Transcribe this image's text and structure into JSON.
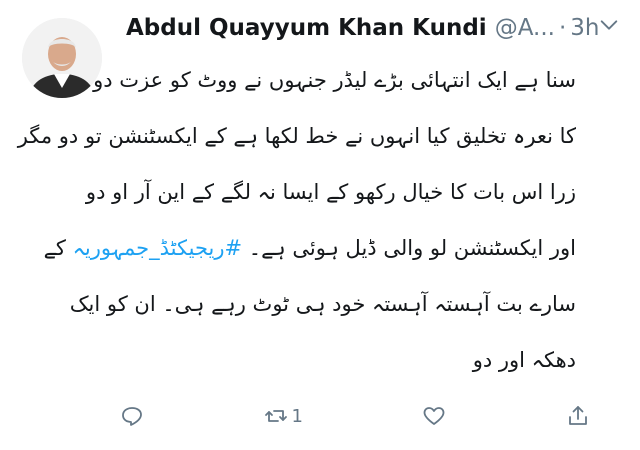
{
  "user": {
    "name": "Abdul Quayyum Khan Kundi",
    "handle": "@A...",
    "separator": "·",
    "time": "3h"
  },
  "tweet": {
    "lines": [
      "سنا ہے ایک انتہائی بڑے لیڈر جنہوں نے ووٹ کو عزت دو",
      "کا نعرہ تخلیق کیا انہوں نے خط لکھا ہے کے ایکسٹنشن تو دو مگر",
      "زرا اس بات کا خیال رکھو کے ایسا نہ لگے کے این آر او دو",
      "ہے۔",
      "سارے بت آہستہ آہستہ خود ہی ٹوٹ رہے ہی۔ ان کو ایک",
      "دھکہ اور دو"
    ],
    "line4_prefix": "اور ایکسٹنشن لو والی ڈیل ہوئی",
    "hashtag": "#ریجیکٹڈ_جمہوریہ",
    "line4_suffix": "کے"
  },
  "actions": {
    "reply_icon": "reply-icon",
    "retweet_icon": "retweet-icon",
    "retweet_count": "1",
    "like_icon": "heart-icon",
    "share_icon": "share-icon"
  },
  "colors": {
    "text": "#14171a",
    "muted": "#657786",
    "link": "#1da1f2"
  }
}
